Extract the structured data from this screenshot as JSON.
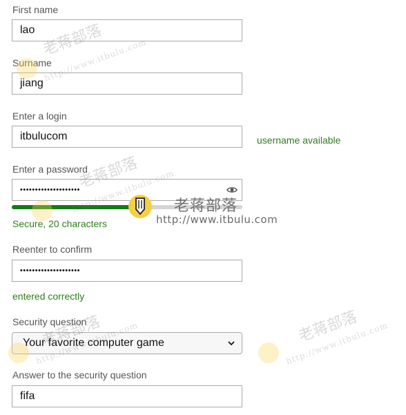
{
  "form": {
    "first_name": {
      "label": "First name",
      "value": "lao"
    },
    "surname": {
      "label": "Surname",
      "value": "jiang"
    },
    "login": {
      "label": "Enter a login",
      "value": "itbulucom",
      "status": "username available"
    },
    "password": {
      "label": "Enter a password",
      "value": "••••••••••••••••••••",
      "strength_text": "Secure, 20 characters",
      "strength_fraction": 0.56,
      "reveal_icon": "eye-icon"
    },
    "confirm": {
      "label": "Reenter to confirm",
      "value": "••••••••••••••••••••",
      "status": "entered correctly"
    },
    "security_question": {
      "label": "Security question",
      "selected": "Your favorite computer game",
      "dropdown_icon": "chevron-down-icon"
    },
    "answer": {
      "label": "Answer to the security question",
      "value": "fifa"
    }
  },
  "watermark": {
    "cn": "老蒋部落",
    "url": "http://www.itbulu.com",
    "url_faint": "http://www.itbulu.com"
  },
  "colors": {
    "success_green": "#2e7d1e",
    "strength_fill": "#157a17",
    "strength_track": "#d5d5d5",
    "border": "#a9a9a9",
    "badge_yellow": "#f5cf45"
  }
}
